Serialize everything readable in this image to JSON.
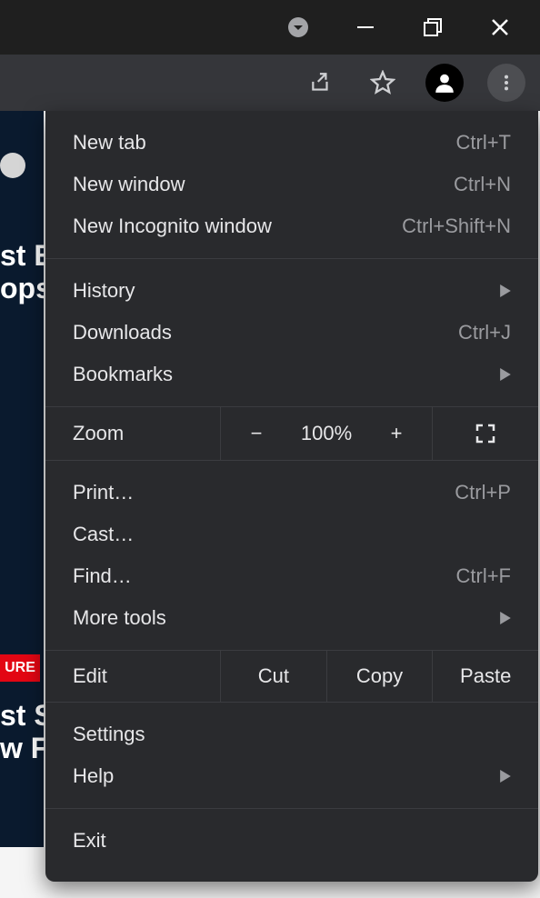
{
  "window": {
    "circle_caret_icon": "circle-caret-down-icon",
    "minimize_icon": "minimize-icon",
    "maximize_icon": "maximize-icon",
    "close_icon": "close-icon"
  },
  "toolbar": {
    "share_icon": "share-icon",
    "bookmark_icon": "bookmark-star-icon",
    "profile_icon": "profile-avatar-icon",
    "menu_icon": "more-vertical-icon"
  },
  "bg": {
    "t1": "st E",
    "t2": "ops",
    "t3": "st S",
    "t4": "w F",
    "chip": "URE"
  },
  "menu": {
    "newtab": {
      "label": "New tab",
      "shortcut": "Ctrl+T"
    },
    "newwin": {
      "label": "New window",
      "shortcut": "Ctrl+N"
    },
    "incog": {
      "label": "New Incognito window",
      "shortcut": "Ctrl+Shift+N"
    },
    "history": {
      "label": "History"
    },
    "downloads": {
      "label": "Downloads",
      "shortcut": "Ctrl+J"
    },
    "bookmarks": {
      "label": "Bookmarks"
    },
    "zoom": {
      "label": "Zoom",
      "value": "100%"
    },
    "print": {
      "label": "Print…",
      "shortcut": "Ctrl+P"
    },
    "cast": {
      "label": "Cast…"
    },
    "find": {
      "label": "Find…",
      "shortcut": "Ctrl+F"
    },
    "moretools": {
      "label": "More tools"
    },
    "edit": {
      "label": "Edit",
      "cut": "Cut",
      "copy": "Copy",
      "paste": "Paste"
    },
    "settings": {
      "label": "Settings"
    },
    "help": {
      "label": "Help"
    },
    "exit": {
      "label": "Exit"
    }
  }
}
